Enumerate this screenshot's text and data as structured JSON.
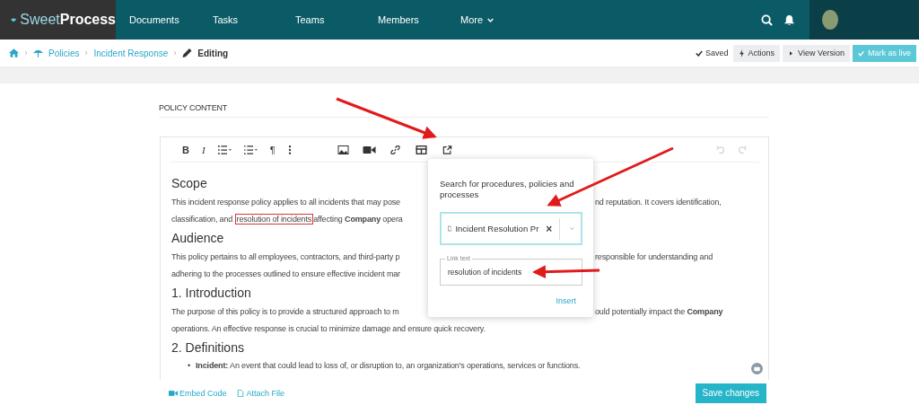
{
  "nav": {
    "logo_light": "Sweet",
    "logo_bold": "Process",
    "items": [
      {
        "label": "Documents",
        "dropdown": false
      },
      {
        "label": "Tasks",
        "dropdown": false
      },
      {
        "label": "Teams",
        "dropdown": false
      },
      {
        "label": "Members",
        "dropdown": false
      },
      {
        "label": "More",
        "dropdown": true
      }
    ]
  },
  "breadcrumb": {
    "items": [
      {
        "label": "Policies",
        "kind": "link"
      },
      {
        "label": "Incident Response",
        "kind": "link"
      },
      {
        "label": "Editing",
        "kind": "current"
      }
    ]
  },
  "status": "Saved",
  "actions": [
    {
      "label": "Actions",
      "kind": "actions"
    },
    {
      "label": "View Version",
      "kind": "view"
    },
    {
      "label": "Mark as live",
      "kind": "primary"
    }
  ],
  "section_title": "POLICY CONTENT",
  "toolbar": {
    "bold": "B",
    "italic": "I",
    "paragraph": "¶"
  },
  "content": [
    {
      "heading": "Scope",
      "lines": [
        {
          "covered": true,
          "parts": [
            {
              "text": "This incident response policy applies to all incidents that may pose",
              "kind": "plain"
            }
          ],
          "right": "nd reputation. It covers identification,"
        },
        {
          "covered": true,
          "parts": [
            {
              "text": "classification, and ",
              "kind": "plain"
            },
            {
              "text": "resolution of incidents",
              "kind": "boxed"
            },
            {
              "text": "affecting **Company** opera",
              "kind": "plain"
            }
          ]
        }
      ]
    },
    {
      "heading": "Audience",
      "lines": [
        {
          "covered": true,
          "parts": [
            {
              "text": "This policy pertains to all employees, contractors, and third-party p",
              "kind": "plain"
            }
          ],
          "right": "responsible for understanding and"
        },
        {
          "covered": true,
          "parts": [
            {
              "text": "adhering to the processes outlined to ensure effective incident mar",
              "kind": "plain"
            }
          ]
        }
      ]
    },
    {
      "heading": "1. Introduction",
      "lines": [
        {
          "covered": true,
          "parts": [
            {
              "text": "The purpose of this policy is to provide a structured approach to m",
              "kind": "plain"
            }
          ],
          "right": "ould potentially impact the **Company**"
        },
        {
          "covered": false,
          "parts": [
            {
              "text": "operations. An effective response is crucial to minimize damage and ensure quick recovery.",
              "kind": "plain"
            }
          ]
        }
      ]
    },
    {
      "heading": "2. Definitions",
      "bullet_marker": "•",
      "bullets": [
        "**Incident:** An event that could lead to loss of, or disruption to, an organization's operations, services or functions."
      ]
    }
  ],
  "footer_links": [
    {
      "label": "Embed Code",
      "kind": "video"
    },
    {
      "label": "Attach File",
      "kind": "file"
    }
  ],
  "save_button": "Save changes",
  "popup": {
    "title": "Search for procedures, policies and processes",
    "selected": "Incident Resolution Pr",
    "clear": "×",
    "link_label": "Link text",
    "link_value": "resolution of incidents",
    "insert": "Insert"
  }
}
